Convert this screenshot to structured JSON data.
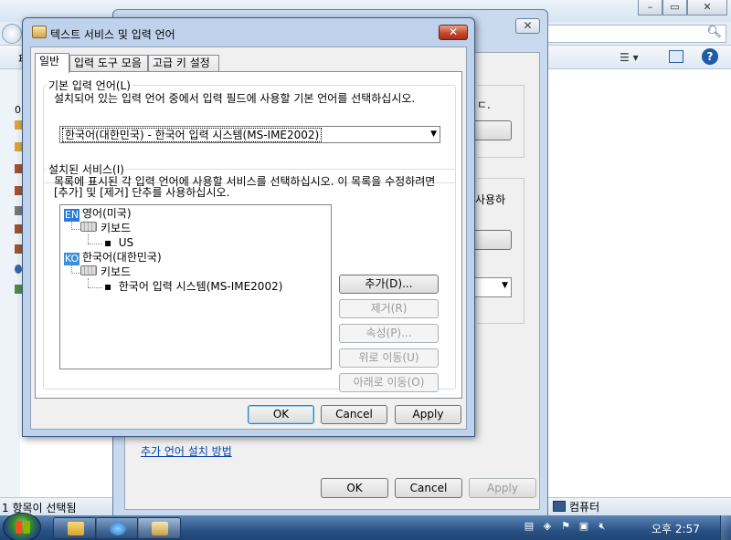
{
  "background_window": {
    "search_placeholder": "검색",
    "toolbar_left_fragment": "구",
    "addr_fragment": "파",
    "left_fragment": "0",
    "status_left": "1 항목이 선택됨",
    "status_right": "컴퓨터",
    "caption": {
      "minimize": "–",
      "maximize": "▭",
      "close": "✕"
    }
  },
  "middle_window": {
    "close_label": "✕",
    "fragment_1": "ㄷ.",
    "fragment_2": "사용하",
    "link_text": "추가 언어 설치 방법",
    "buttons": {
      "ok": "OK",
      "cancel": "Cancel",
      "apply": "Apply"
    }
  },
  "dialog": {
    "title": "텍스트 서비스 및 입력 언어",
    "close_label": "✕",
    "tabs": [
      "일반",
      "입력 도구 모음",
      "고급 키 설정"
    ],
    "default_language": {
      "legend": "기본 입력 언어(L)",
      "description": "설치되어 있는 입력 언어 중에서 입력 필드에 사용할 기본 언어를 선택하십시오.",
      "selected": "한국어(대한민국) - 한국어 입력 시스템(MS-IME2002)"
    },
    "installed_services": {
      "legend": "설치된 서비스(I)",
      "description": "목록에 표시된 각 입력 언어에 사용할 서비스를 선택하십시오. 이 목록을 수정하려면 [추가] 및 [제거] 단추를 사용하십시오.",
      "tree": [
        {
          "badge": "EN",
          "label": "영어(미국)",
          "kbd_label": "키보드",
          "item": "US"
        },
        {
          "badge": "KO",
          "label": "한국어(대한민국)",
          "kbd_label": "키보드",
          "item": "한국어 입력 시스템(MS-IME2002)"
        }
      ],
      "buttons": {
        "add": "추가(D)...",
        "remove": "제거(R)",
        "properties": "속성(P)...",
        "move_up": "위로 이동(U)",
        "move_down": "아래로 이동(O)"
      }
    },
    "footer": {
      "ok": "OK",
      "cancel": "Cancel",
      "apply": "Apply"
    }
  },
  "taskbar": {
    "clock": "오후 2:57"
  }
}
